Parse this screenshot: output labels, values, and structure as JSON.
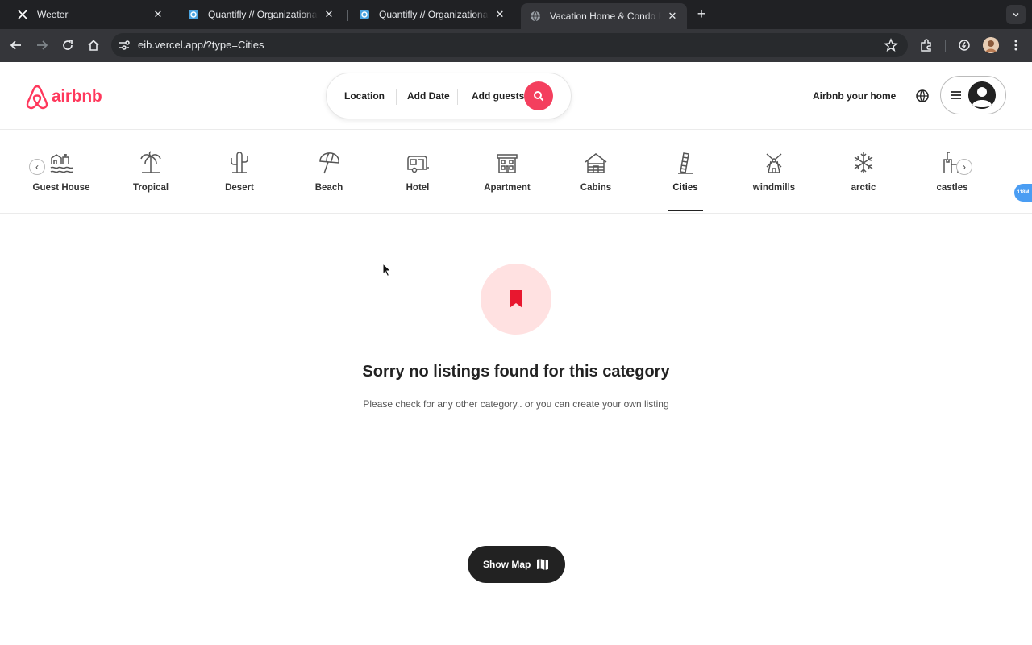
{
  "browser": {
    "tabs": [
      {
        "title": "Weeter",
        "favicon": "x-logo-icon",
        "active": false
      },
      {
        "title": "Quantifly // Organizational Dia",
        "favicon": "quantifly-icon",
        "active": false
      },
      {
        "title": "Quantifly // Organizational Dia",
        "favicon": "quantifly-icon",
        "active": false
      },
      {
        "title": "Vacation Home & Condo Rent",
        "favicon": "globe-icon",
        "active": true
      }
    ],
    "url": "eib.vercel.app/?type=Cities"
  },
  "header": {
    "brand": "airbnb",
    "search": {
      "location": "Location",
      "date": "Add Date",
      "guests": "Add guests"
    },
    "host_link": "Airbnb your home"
  },
  "categories": {
    "selected": "Cities",
    "items": [
      {
        "label": "Guest House",
        "icon": "guest-house-icon"
      },
      {
        "label": "Tropical",
        "icon": "palm-tree-icon"
      },
      {
        "label": "Desert",
        "icon": "cactus-icon"
      },
      {
        "label": "Beach",
        "icon": "umbrella-icon"
      },
      {
        "label": "Hotel",
        "icon": "caravan-icon"
      },
      {
        "label": "Apartment",
        "icon": "apartment-icon"
      },
      {
        "label": "Cabins",
        "icon": "cabin-icon"
      },
      {
        "label": "Cities",
        "icon": "leaning-tower-icon"
      },
      {
        "label": "windmills",
        "icon": "windmill-icon"
      },
      {
        "label": "arctic",
        "icon": "snowflake-icon"
      },
      {
        "label": "castles",
        "icon": "castle-icon"
      }
    ]
  },
  "extension_badge": "118M",
  "empty_state": {
    "title": "Sorry no listings found for this category",
    "subtitle": "Please check for any other category.. or you can create your own listing"
  },
  "show_map": {
    "label": "Show Map"
  },
  "colors": {
    "brand": "#ff385c",
    "search_button": "#f43f5e",
    "empty_circle": "#ffe1e1",
    "bookmark": "#e8172f"
  }
}
